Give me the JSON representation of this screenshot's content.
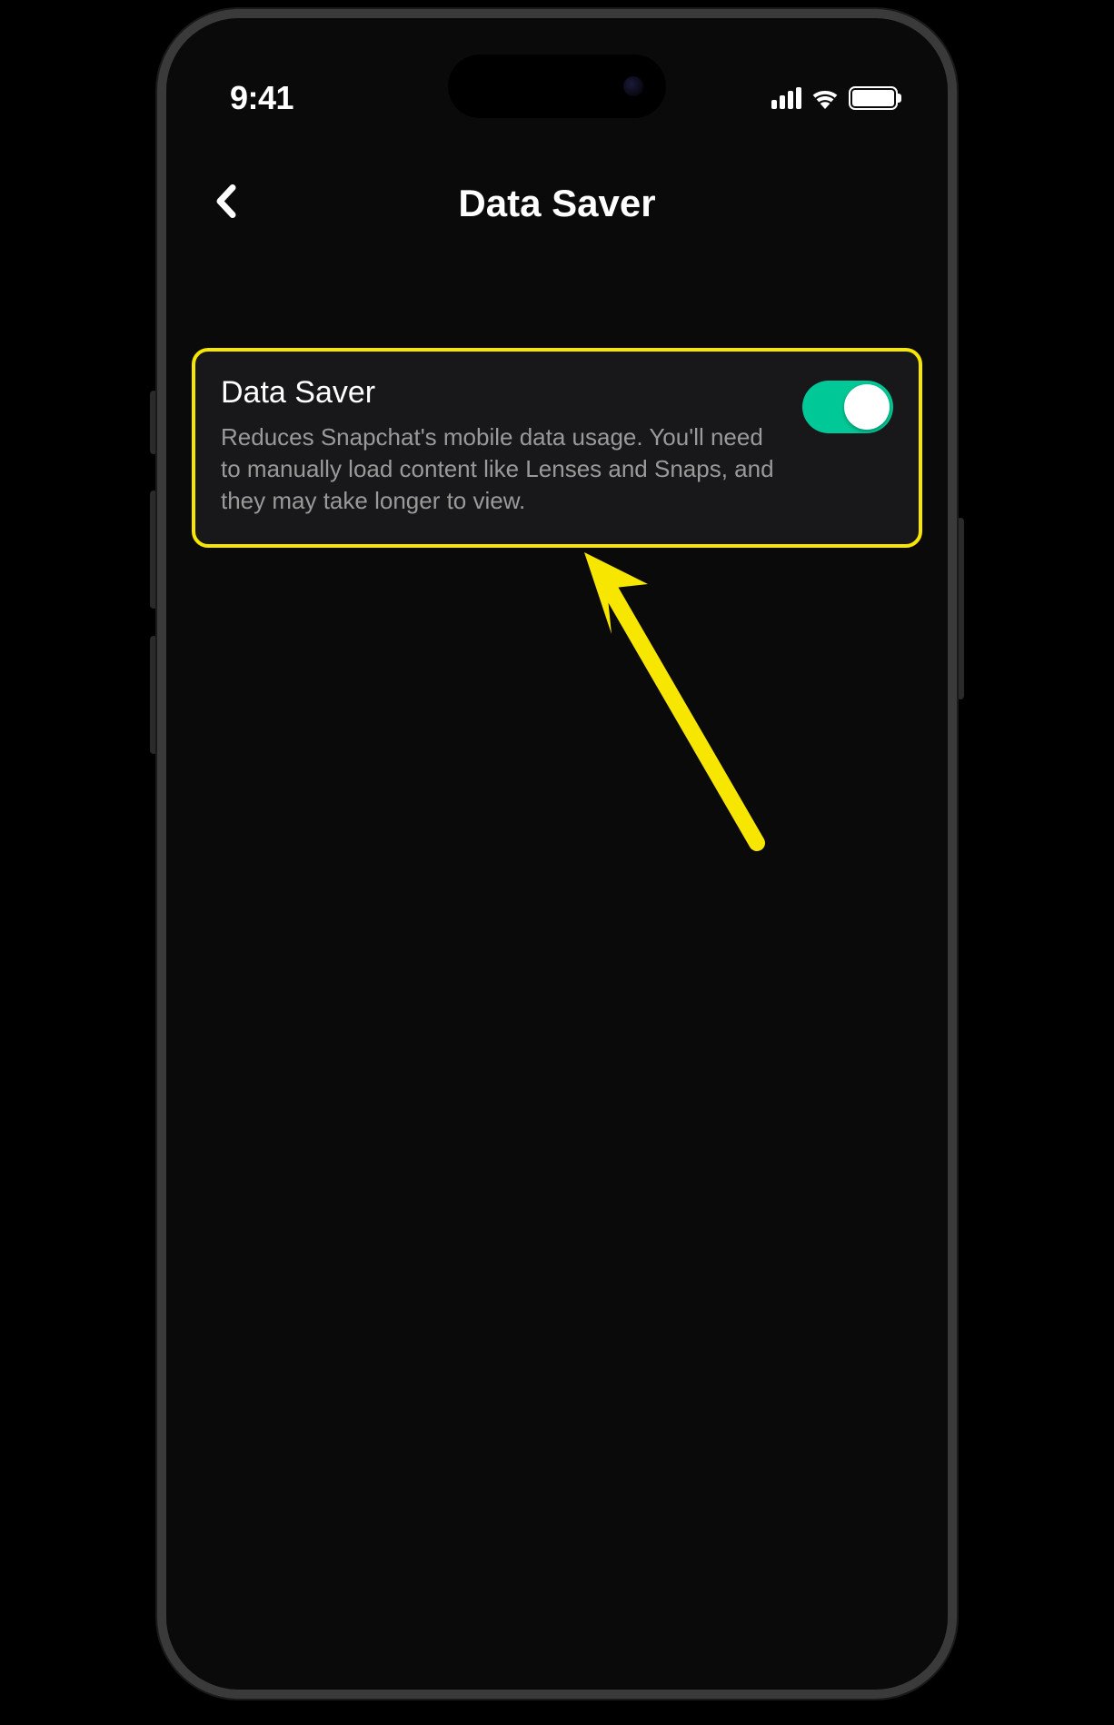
{
  "status_bar": {
    "time": "9:41"
  },
  "header": {
    "title": "Data Saver"
  },
  "setting": {
    "title": "Data Saver",
    "description": "Reduces Snapchat's mobile data usage. You'll need to manually load content like Lenses and Snaps, and they may take longer to view.",
    "enabled": true
  },
  "annotation": {
    "highlight_color": "#f7e600",
    "toggle_on_color": "#00c896"
  }
}
